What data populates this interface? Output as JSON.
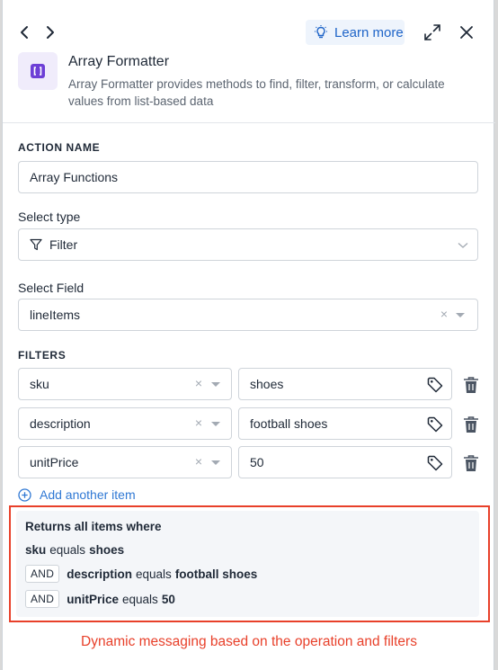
{
  "topbar": {
    "learn_more_label": "Learn more",
    "back_icon": "chevron-left-icon",
    "forward_icon": "chevron-right-icon",
    "expand_icon": "expand-icon",
    "close_icon": "close-icon"
  },
  "app": {
    "title": "Array Formatter",
    "description": "Array Formatter provides methods to find, filter, transform, or calculate values from list-based data",
    "icon": "brackets-icon",
    "accent": "#6d3fd6"
  },
  "form": {
    "action_name_label": "ACTION NAME",
    "action_name_value": "Array Functions",
    "select_type_label": "Select type",
    "select_type_value": "Filter",
    "select_field_label": "Select Field",
    "select_field_value": "lineItems",
    "clear_glyph": "×"
  },
  "filters": {
    "label": "FILTERS",
    "rows": [
      {
        "field": "sku",
        "value": "shoes"
      },
      {
        "field": "description",
        "value": "football shoes"
      },
      {
        "field": "unitPrice",
        "value": "50"
      }
    ],
    "add_label": "Add another item"
  },
  "summary": {
    "title": "Returns all items where",
    "line1": {
      "field": "sku",
      "op": "equals",
      "value": "shoes"
    },
    "line2": {
      "chip": "AND",
      "field": "description",
      "op": "equals",
      "value": "football shoes"
    },
    "line3": {
      "chip": "AND",
      "field": "unitPrice",
      "op": "equals",
      "value": "50"
    }
  },
  "annotation": "Dynamic messaging based on the operation and filters",
  "colors": {
    "link": "#2f78d4",
    "annotation_red": "#e8402a",
    "learn_bg": "#eef4fc"
  }
}
